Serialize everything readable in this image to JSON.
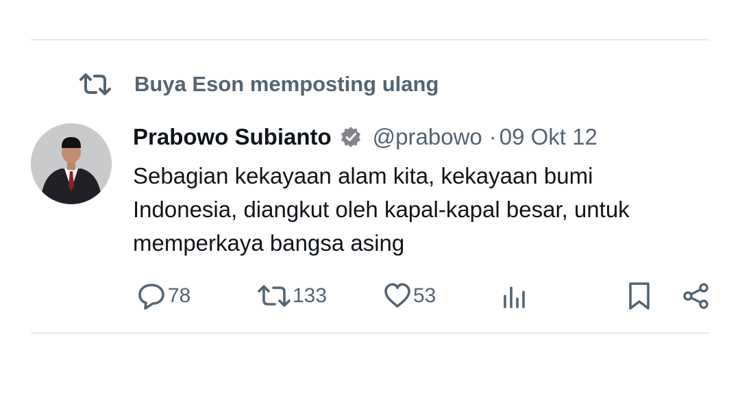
{
  "repost_banner": {
    "icon": "repost-icon",
    "label": "Buya Eson memposting ulang"
  },
  "tweet": {
    "author_name": "Prabowo Subianto",
    "verified_icon": "verified-badge-icon",
    "handle": "@prabowo",
    "separator": "·",
    "date": "09 Okt 12",
    "text_lines": [
      "Sebagian kekayaan alam kita, kekayaan bumi",
      "Indonesia, diangkut oleh kapal-kapal besar, untuk",
      "memperkaya bangsa asing"
    ]
  },
  "actions": {
    "reply": {
      "icon": "reply-icon",
      "count": "78"
    },
    "repost": {
      "icon": "repost-icon",
      "count": "133"
    },
    "like": {
      "icon": "heart-icon",
      "count": "53"
    },
    "views": {
      "icon": "views-icon"
    },
    "bookmark": {
      "icon": "bookmark-icon"
    },
    "share": {
      "icon": "share-icon"
    }
  },
  "colors": {
    "text_primary": "#0f1419",
    "text_secondary": "#536471",
    "divider": "#e4e8eb"
  }
}
